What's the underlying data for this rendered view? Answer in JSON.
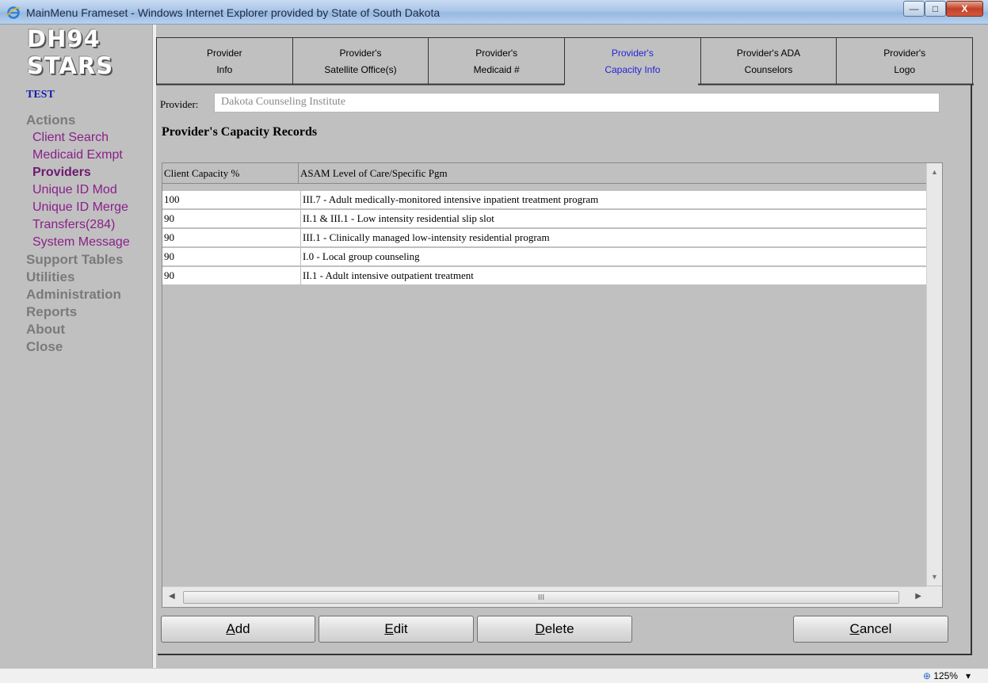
{
  "window": {
    "title": "MainMenu Frameset - Windows Internet Explorer provided by State of South Dakota",
    "minimize_glyph": "—",
    "maximize_glyph": "□",
    "close_glyph": "X"
  },
  "sidebar": {
    "logo_line1": "DH94",
    "logo_line2": "STARS",
    "environment": "TEST",
    "actions_header": "Actions",
    "actions_items": [
      {
        "label": "Client Search"
      },
      {
        "label": "Medicaid Exmpt"
      },
      {
        "label": "Providers",
        "active": true
      },
      {
        "label": "Unique ID Mod"
      },
      {
        "label": "Unique ID Merge"
      },
      {
        "label": "Transfers(284)"
      },
      {
        "label": "System Message"
      }
    ],
    "sections": [
      "Support Tables",
      "Utilities",
      "Administration",
      "Reports",
      "About",
      "Close"
    ]
  },
  "tabs": [
    {
      "line1": "Provider",
      "line2": "Info"
    },
    {
      "line1": "Provider's",
      "line2": "Satellite Office(s)"
    },
    {
      "line1": "Provider's",
      "line2": "Medicaid #"
    },
    {
      "line1": "Provider's",
      "line2": "Capacity Info",
      "active": true
    },
    {
      "line1": "Provider's ADA",
      "line2": "Counselors"
    },
    {
      "line1": "Provider's",
      "line2": "Logo"
    }
  ],
  "provider": {
    "label": "Provider:",
    "value": "Dakota Counseling Institute"
  },
  "section_title": "Provider's Capacity Records",
  "grid": {
    "columns": [
      "Client Capacity %",
      "ASAM Level of Care/Specific Pgm"
    ],
    "rows": [
      [
        "100",
        "III.7 - Adult medically-monitored intensive inpatient treatment program"
      ],
      [
        "90",
        "II.1 & III.1 - Low intensity residential slip slot"
      ],
      [
        "90",
        "III.1 - Clinically managed low-intensity residential program"
      ],
      [
        "90",
        "I.0 - Local group counseling"
      ],
      [
        "90",
        "II.1 - Adult intensive outpatient treatment"
      ]
    ],
    "hscroll_grip": "III"
  },
  "buttons": {
    "add": {
      "ul": "A",
      "rest": "dd"
    },
    "edit": {
      "ul": "E",
      "rest": "dit"
    },
    "delete": {
      "ul": "D",
      "rest": "elete"
    },
    "cancel": {
      "ul": "C",
      "rest": "ancel"
    }
  },
  "status": {
    "zoom": "125%"
  },
  "colors": {
    "link_purple": "#8a1f8a",
    "active_tab_blue": "#2323d8",
    "env_blue": "#1a1ab4"
  }
}
